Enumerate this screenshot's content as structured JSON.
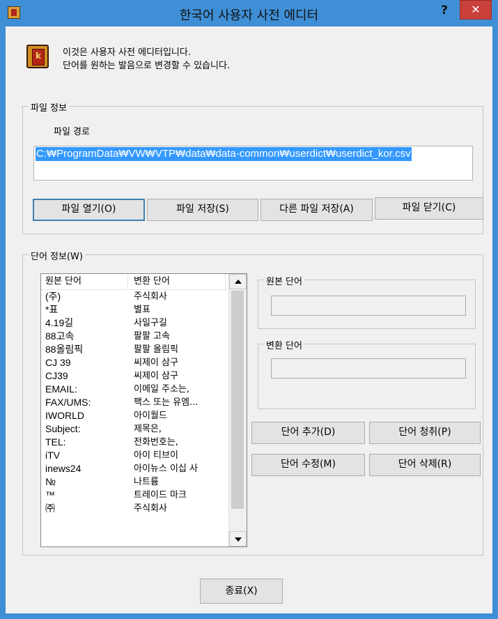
{
  "window": {
    "title": "한국어 사용자 사전 에디터",
    "help_label": "?",
    "close_label": "✕"
  },
  "intro": {
    "line1": "이것은 사용자 사전 에디터입니다.",
    "line2": "단어를 원하는 발음으로 변경할 수 있습니다."
  },
  "file_info": {
    "group_title": "파일 정보",
    "path_label": "파일 경로",
    "path_value": "C:₩ProgramData₩VW₩VTP₩data₩data-common₩userdict₩userdict_kor.csv",
    "buttons": {
      "open": "파일 열기(O)",
      "save": "파일 저장(S)",
      "save_as": "다른 파일 저장(A)",
      "close": "파일 닫기(C)"
    }
  },
  "word_info": {
    "group_title": "단어 정보(W)",
    "columns": [
      "원본 단어",
      "변환 단어"
    ],
    "rows": [
      [
        "(주)",
        "주식회사"
      ],
      [
        "*표",
        "별표"
      ],
      [
        "4.19길",
        "사일구길"
      ],
      [
        "88고속",
        "팔팔 고속"
      ],
      [
        "88올림픽",
        "팔팔 올림픽"
      ],
      [
        "CJ 39",
        "씨제이 삼구"
      ],
      [
        "CJ39",
        "씨제이 삼구"
      ],
      [
        "EMAIL:",
        "이메일 주소는,"
      ],
      [
        "FAX/UMS:",
        "팩스 또는 유엠..."
      ],
      [
        "IWORLD",
        "아이월드"
      ],
      [
        "Subject:",
        "제목은,"
      ],
      [
        "TEL:",
        "전화번호는,"
      ],
      [
        "iTV",
        "아이 티브이"
      ],
      [
        "inews24",
        "아이뉴스 이십 사"
      ],
      [
        "№",
        "나트륨"
      ],
      [
        "™",
        "트레이드 마크"
      ],
      [
        "㈜",
        "주식회사"
      ]
    ],
    "source_group": "원본 단어",
    "source_value": "",
    "target_group": "변환 단어",
    "target_value": "",
    "buttons": {
      "add": "단어 추가(D)",
      "clear": "단어 청취(P)",
      "edit": "단어 수정(M)",
      "delete": "단어 삭제(R)"
    }
  },
  "exit_label": "종료(X)",
  "colors": {
    "title_bar": "#3f8fd6",
    "close_button": "#c9403a",
    "selection": "#3399ff"
  }
}
